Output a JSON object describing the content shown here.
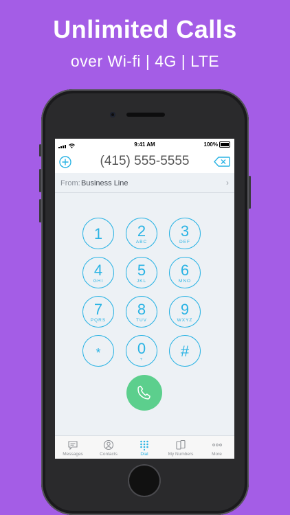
{
  "headline": "Unlimited Calls",
  "subline": "over Wi-fi | 4G | LTE",
  "status": {
    "time": "9:41 AM",
    "battery": "100%"
  },
  "dialer": {
    "number": "(415) 555-5555",
    "from_label": "From:",
    "from_value": "Business Line"
  },
  "keypad": [
    {
      "digit": "1",
      "letters": ""
    },
    {
      "digit": "2",
      "letters": "ABC"
    },
    {
      "digit": "3",
      "letters": "DEF"
    },
    {
      "digit": "4",
      "letters": "GHI"
    },
    {
      "digit": "5",
      "letters": "JKL"
    },
    {
      "digit": "6",
      "letters": "MNO"
    },
    {
      "digit": "7",
      "letters": "PQRS"
    },
    {
      "digit": "8",
      "letters": "TUV"
    },
    {
      "digit": "9",
      "letters": "WXYZ"
    },
    {
      "digit": "*",
      "letters": ""
    },
    {
      "digit": "0",
      "letters": "+"
    },
    {
      "digit": "#",
      "letters": ""
    }
  ],
  "tabs": [
    {
      "label": "Messages",
      "icon": "chat-bubble-icon",
      "active": false
    },
    {
      "label": "Contacts",
      "icon": "contact-icon",
      "active": false
    },
    {
      "label": "Dial",
      "icon": "dialpad-icon",
      "active": true
    },
    {
      "label": "My Numbers",
      "icon": "phones-icon",
      "active": false
    },
    {
      "label": "More",
      "icon": "more-dots-icon",
      "active": false
    }
  ],
  "colors": {
    "background": "#a45de6",
    "accent": "#2ab3e4",
    "call": "#5ccf8d"
  }
}
